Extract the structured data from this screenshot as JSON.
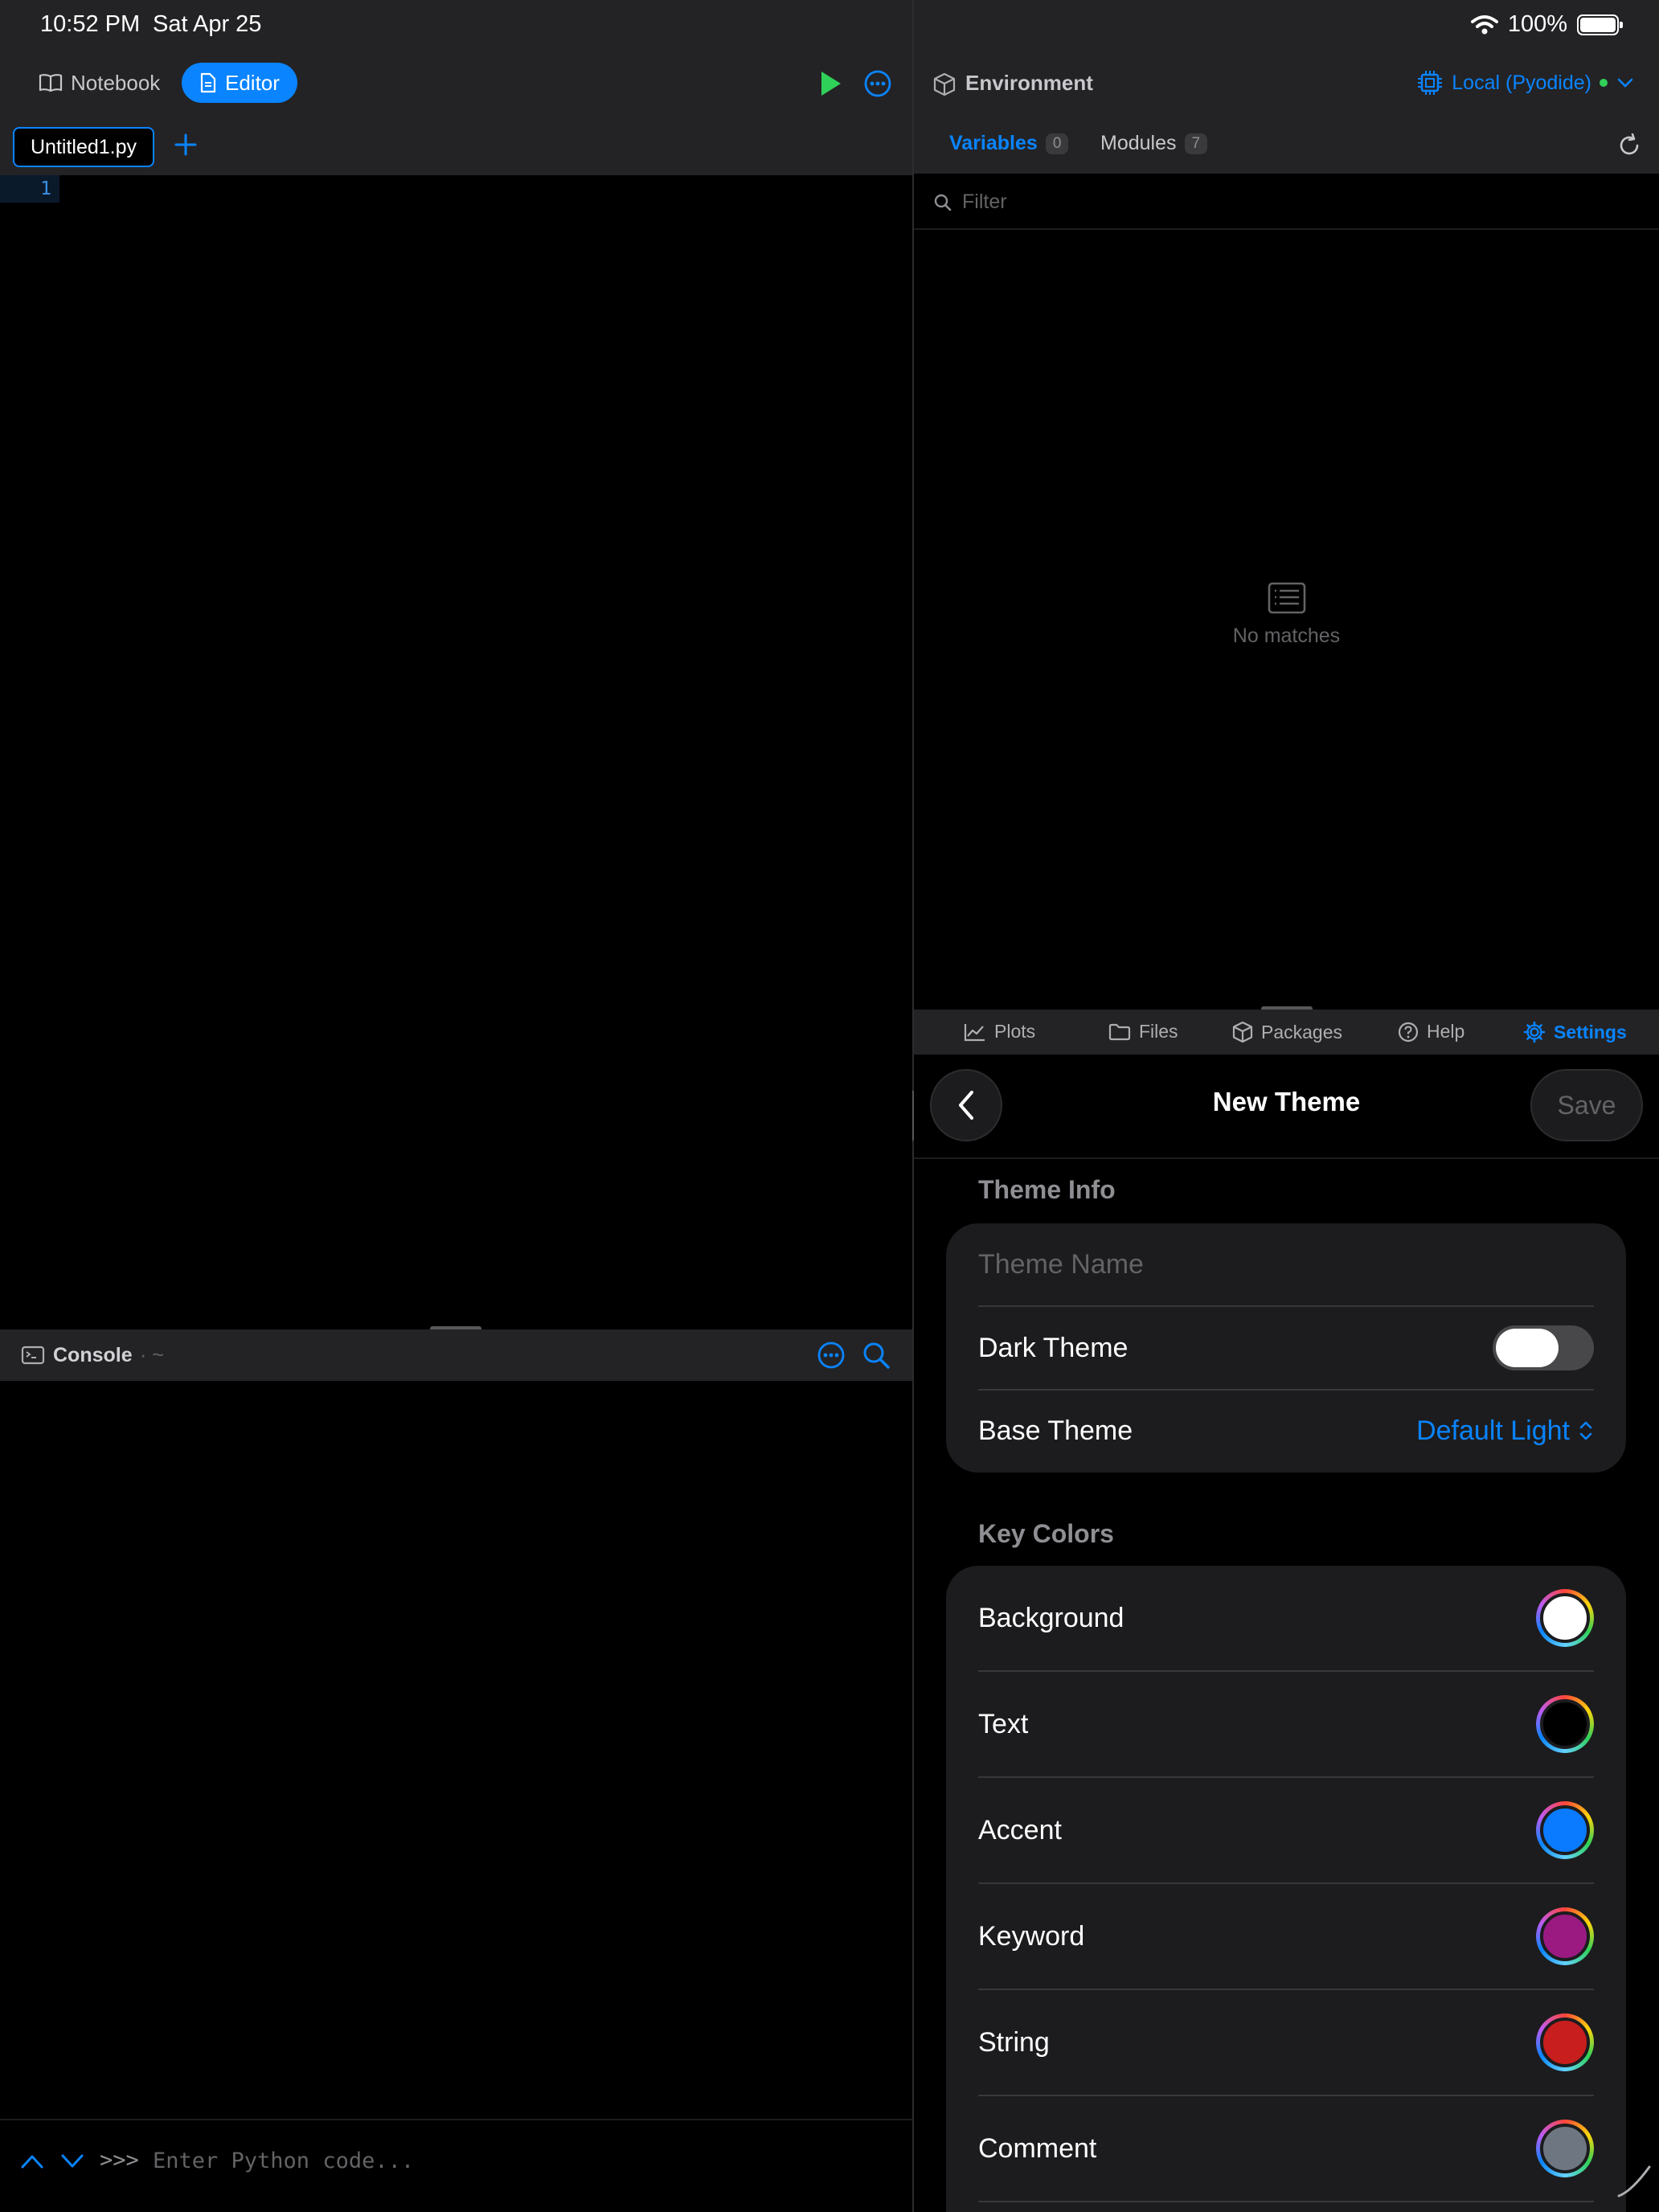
{
  "status_bar": {
    "time": "10:52 PM",
    "date": "Sat Apr 25",
    "battery": "100%"
  },
  "left_toolbar": {
    "notebook_label": "Notebook",
    "editor_label": "Editor"
  },
  "editor": {
    "tab_name": "Untitled1.py",
    "line_number": "1"
  },
  "console": {
    "title": "Console",
    "path": "· ~",
    "prompt": ">>>",
    "placeholder": "Enter Python code..."
  },
  "environment": {
    "title": "Environment",
    "kernel": "Local (Pyodide)",
    "tabs": [
      {
        "label": "Variables",
        "count": "0"
      },
      {
        "label": "Modules",
        "count": "7"
      }
    ],
    "filter_placeholder": "Filter",
    "empty_text": "No matches"
  },
  "bottom_tabs": [
    {
      "label": "Plots"
    },
    {
      "label": "Files"
    },
    {
      "label": "Packages"
    },
    {
      "label": "Help"
    },
    {
      "label": "Settings"
    }
  ],
  "new_theme": {
    "title": "New Theme",
    "save_label": "Save",
    "theme_info_header": "Theme Info",
    "theme_name_placeholder": "Theme Name",
    "dark_theme_label": "Dark Theme",
    "dark_theme_on": false,
    "base_theme_label": "Base Theme",
    "base_theme_value": "Default Light",
    "key_colors_header": "Key Colors",
    "key_colors": [
      {
        "label": "Background",
        "color": "#ffffff"
      },
      {
        "label": "Text",
        "color": "#000000"
      },
      {
        "label": "Accent",
        "color": "#0a7aff"
      },
      {
        "label": "Keyword",
        "color": "#9b1a82"
      },
      {
        "label": "String",
        "color": "#c81e1e"
      },
      {
        "label": "Comment",
        "color": "#6e7781"
      }
    ]
  },
  "colors": {
    "accent": "#0a84ff",
    "run": "#30d158",
    "panel": "#232325",
    "card": "#1c1c1e"
  }
}
